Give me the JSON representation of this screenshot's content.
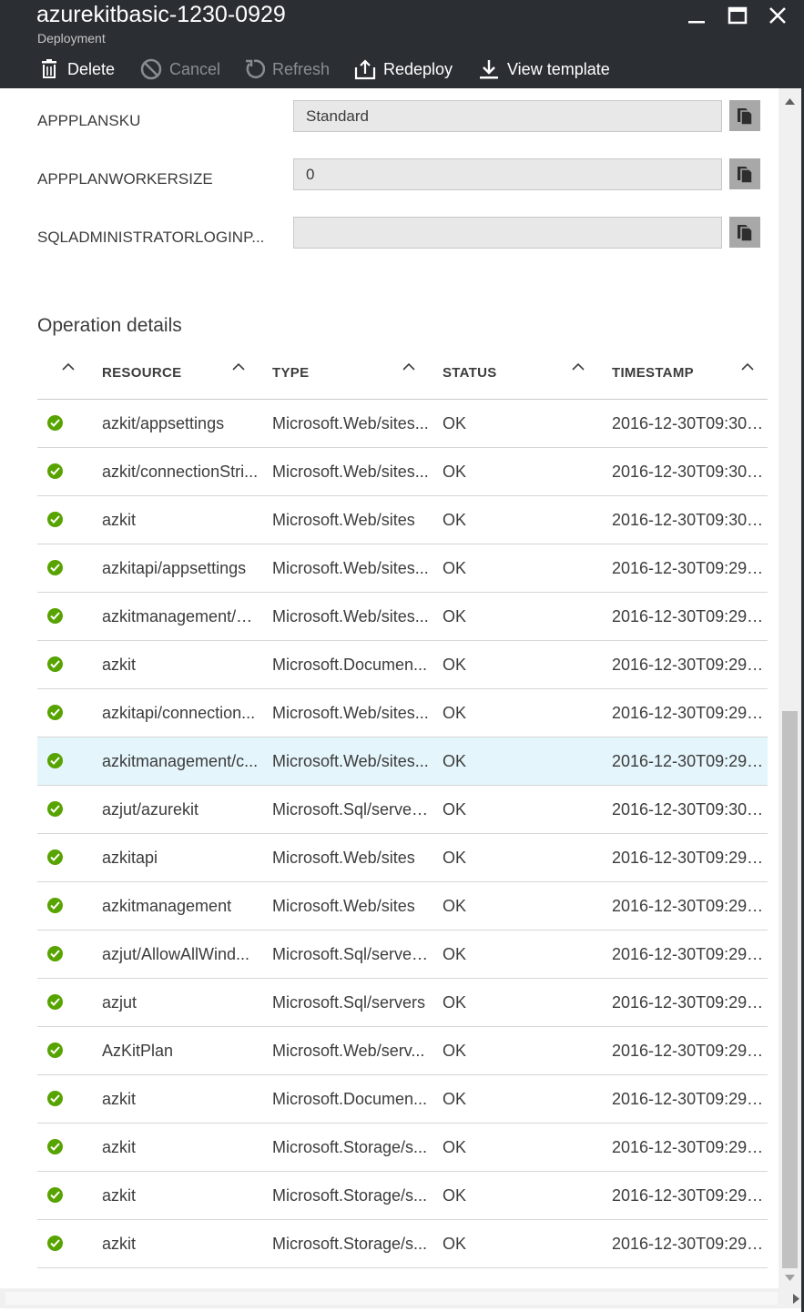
{
  "header": {
    "title": "azurekitbasic-1230-0929",
    "subtitle": "Deployment"
  },
  "toolbar": {
    "delete": "Delete",
    "cancel": "Cancel",
    "refresh": "Refresh",
    "redeploy": "Redeploy",
    "view_template": "View template"
  },
  "parameters": [
    {
      "label": "APPPLANSKU",
      "value": "Standard"
    },
    {
      "label": "APPPLANWORKERSIZE",
      "value": "0"
    },
    {
      "label": "SQLADMINISTRATORLOGINP...",
      "value": ""
    }
  ],
  "operations": {
    "title": "Operation details",
    "columns": [
      "RESOURCE",
      "TYPE",
      "STATUS",
      "TIMESTAMP"
    ],
    "rows": [
      {
        "resource": "azkit/appsettings",
        "type": "Microsoft.Web/sites...",
        "status": "OK",
        "timestamp": "2016-12-30T09:30:0..."
      },
      {
        "resource": "azkit/connectionStri...",
        "type": "Microsoft.Web/sites...",
        "status": "OK",
        "timestamp": "2016-12-30T09:30:0..."
      },
      {
        "resource": "azkit",
        "type": "Microsoft.Web/sites",
        "status": "OK",
        "timestamp": "2016-12-30T09:30:0..."
      },
      {
        "resource": "azkitapi/appsettings",
        "type": "Microsoft.Web/sites...",
        "status": "OK",
        "timestamp": "2016-12-30T09:29:4..."
      },
      {
        "resource": "azkitmanagement/a...",
        "type": "Microsoft.Web/sites...",
        "status": "OK",
        "timestamp": "2016-12-30T09:29:4..."
      },
      {
        "resource": "azkit",
        "type": "Microsoft.Documen...",
        "status": "OK",
        "timestamp": "2016-12-30T09:29:4..."
      },
      {
        "resource": "azkitapi/connection...",
        "type": "Microsoft.Web/sites...",
        "status": "OK",
        "timestamp": "2016-12-30T09:29:2..."
      },
      {
        "resource": "azkitmanagement/c...",
        "type": "Microsoft.Web/sites...",
        "status": "OK",
        "timestamp": "2016-12-30T09:29:2...",
        "selected": true
      },
      {
        "resource": "azjut/azurekit",
        "type": "Microsoft.Sql/server...",
        "status": "OK",
        "timestamp": "2016-12-30T09:30:0..."
      },
      {
        "resource": "azkitapi",
        "type": "Microsoft.Web/sites",
        "status": "OK",
        "timestamp": "2016-12-30T09:29:2..."
      },
      {
        "resource": "azkitmanagement",
        "type": "Microsoft.Web/sites",
        "status": "OK",
        "timestamp": "2016-12-30T09:29:2..."
      },
      {
        "resource": "azjut/AllowAllWind...",
        "type": "Microsoft.Sql/server...",
        "status": "OK",
        "timestamp": "2016-12-30T09:29:2..."
      },
      {
        "resource": "azjut",
        "type": "Microsoft.Sql/servers",
        "status": "OK",
        "timestamp": "2016-12-30T09:29:2..."
      },
      {
        "resource": "AzKitPlan",
        "type": "Microsoft.Web/serv...",
        "status": "OK",
        "timestamp": "2016-12-30T09:29:2..."
      },
      {
        "resource": "azkit",
        "type": "Microsoft.Documen...",
        "status": "OK",
        "timestamp": "2016-12-30T09:29:4..."
      },
      {
        "resource": "azkit",
        "type": "Microsoft.Storage/s...",
        "status": "OK",
        "timestamp": "2016-12-30T09:29:2..."
      },
      {
        "resource": "azkit",
        "type": "Microsoft.Storage/s...",
        "status": "OK",
        "timestamp": "2016-12-30T09:29:2..."
      },
      {
        "resource": "azkit",
        "type": "Microsoft.Storage/s...",
        "status": "OK",
        "timestamp": "2016-12-30T09:29:2..."
      }
    ]
  },
  "colors": {
    "header_bg": "#2b2f34",
    "status_ok": "#57a300",
    "selected_row": "#e4f5fb",
    "input_bg": "#e8e8e8"
  },
  "icons": {
    "delete": "trash-icon",
    "cancel": "cancel-icon",
    "refresh": "refresh-icon",
    "redeploy": "upload-icon",
    "view_template": "download-icon",
    "copy": "copy-icon",
    "status": "check-circle-icon"
  }
}
